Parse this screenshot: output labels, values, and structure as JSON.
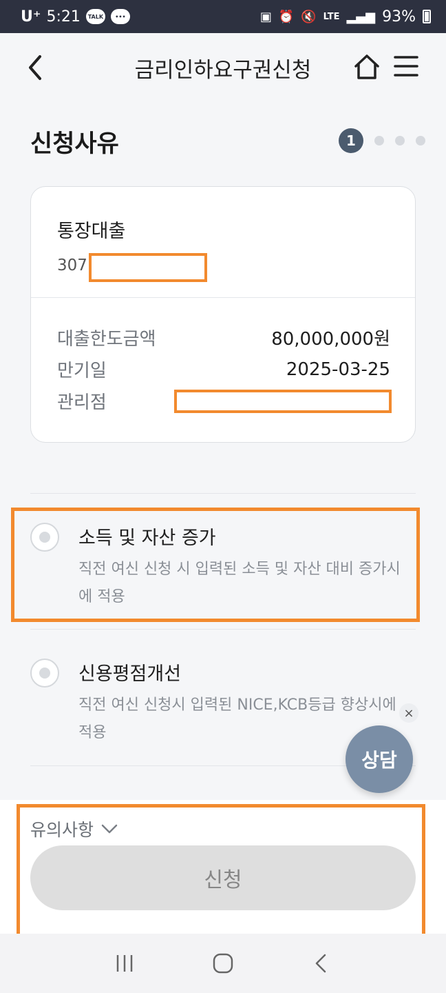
{
  "status_bar": {
    "carrier": "U⁺",
    "time": "5:21",
    "talk_badge": "TALK",
    "network": "LTE",
    "battery": "93%"
  },
  "header": {
    "title": "금리인하요구권신청"
  },
  "section": {
    "title": "신청사유",
    "current_step": "1",
    "total_steps": 4
  },
  "loan": {
    "name": "통장대출",
    "account_prefix": "307",
    "rows": [
      {
        "label": "대출한도금액",
        "value": "80,000,000원"
      },
      {
        "label": "만기일",
        "value": "2025-03-25"
      },
      {
        "label": "관리점",
        "value": ""
      }
    ]
  },
  "options": [
    {
      "title": "소득 및 자산 증가",
      "desc": "직전 여신 신청 시 입력된 소득 및 자산 대비 증가시에 적용"
    },
    {
      "title": "신용평점개선",
      "desc": "직전 여신 신청시 입력된 NICE,KCB등급 향상시에 적용"
    }
  ],
  "chat": {
    "label": "상담",
    "close": "×"
  },
  "bottom": {
    "notice_label": "유의사항",
    "submit_label": "신청"
  },
  "colors": {
    "highlight": "#f28a2e",
    "step_active": "#4b5b6e",
    "chat_fab": "#7a8ea6",
    "status_bar": "#2d3140"
  }
}
